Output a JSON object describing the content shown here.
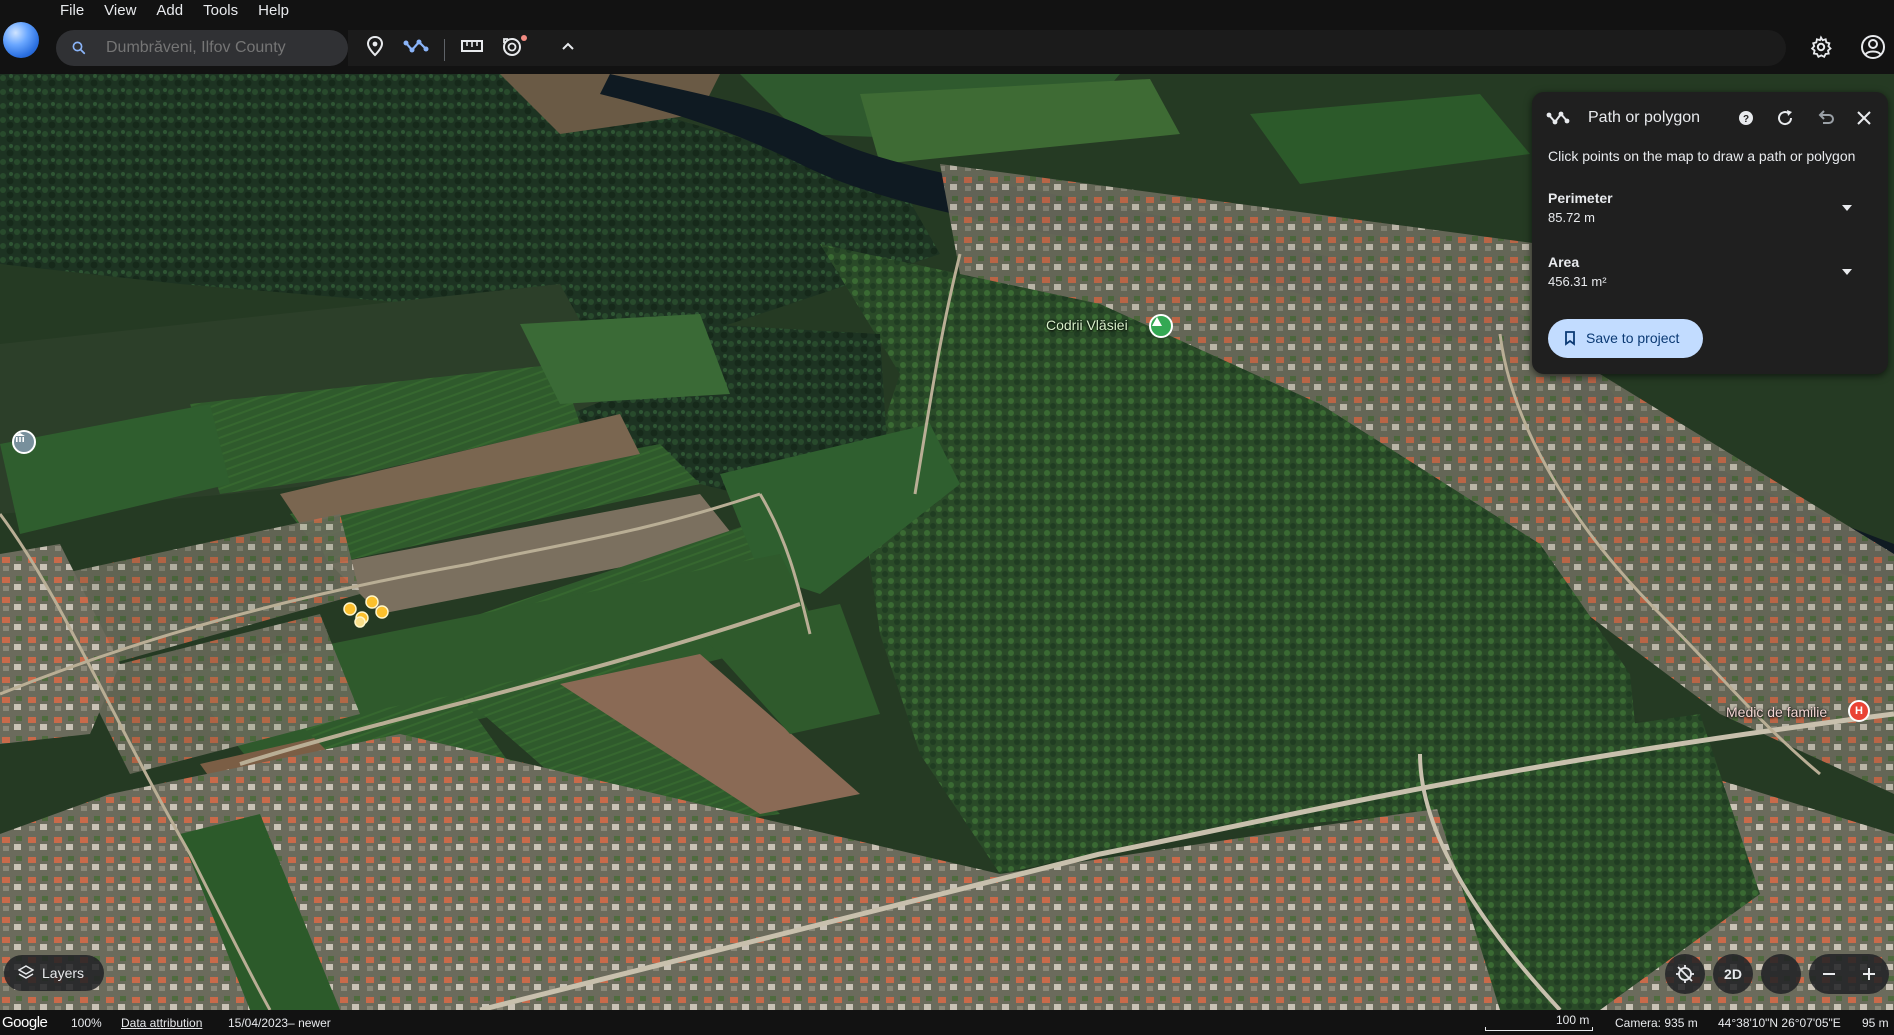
{
  "menu": {
    "items": [
      "File",
      "View",
      "Add",
      "Tools",
      "Help"
    ]
  },
  "search": {
    "placeholder": "Dumbrăveni, Ilfov County",
    "value": ""
  },
  "toolbar": {
    "icons": [
      "place-pin-icon",
      "path-polygon-icon",
      "ruler-icon",
      "history-icon",
      "collapse-chevron-icon"
    ],
    "right_icons": [
      "settings-gear-icon",
      "account-icon"
    ]
  },
  "map": {
    "labels": {
      "forest": "Codrii Vlăsiei",
      "clinic": "Medic de familie"
    },
    "colors": {
      "forest_pin": "#34a853",
      "clinic_pin": "#ea4335",
      "museum_pin": "#78909c",
      "measure_points": "#fbc02d"
    }
  },
  "panel": {
    "title": "Path or polygon",
    "hint": "Click points on the map to draw a path or polygon",
    "perimeter_label": "Perimeter",
    "perimeter_value": "85.72 m",
    "area_label": "Area",
    "area_value": "456.31 m²",
    "save_label": "Save to project",
    "accent": "#c2dcff"
  },
  "controls": {
    "layers_label": "Layers",
    "view_mode_label": "2D"
  },
  "status": {
    "brand": "Google",
    "zoom": "100%",
    "attribution": "Data attribution",
    "imagery_date": "15/04/2023– newer",
    "scale": "100 m",
    "camera": "Camera: 935 m",
    "coordinates": "44°38'10\"N 26°07'05\"E",
    "elevation": "95 m"
  }
}
